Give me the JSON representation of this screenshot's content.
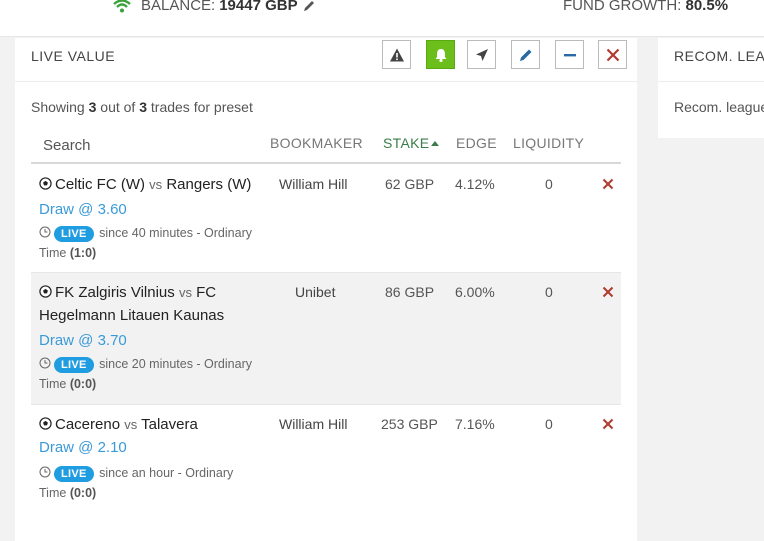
{
  "topbar": {
    "balance_label": "BALANCE:",
    "balance_value": "19447 GBP",
    "growth_label": "FUND GROWTH:",
    "growth_value": "80.5%"
  },
  "panel": {
    "title": "LIVE VALUE",
    "tools": [
      "warning-icon",
      "bell-icon",
      "send-icon",
      "pencil-icon",
      "minus-icon",
      "close-icon"
    ],
    "showing_prefix": "Showing",
    "showing_count": "3",
    "showing_middle": "out of",
    "showing_total": "3",
    "showing_suffix": "trades for preset"
  },
  "table": {
    "search_placeholder": "Search",
    "headers": {
      "bookmaker": "BOOKMAKER",
      "stake": "STAKE",
      "edge": "EDGE",
      "liquidity": "LIQUIDITY"
    },
    "rows": [
      {
        "home": "Celtic FC (W)",
        "vs": "vs",
        "away": "Rangers (W)",
        "bet": "Draw @ 3.60",
        "live": "LIVE",
        "since": "since 40 minutes - Ordinary Time",
        "score": "(1:0)",
        "bookmaker": "William Hill",
        "stake": "62 GBP",
        "edge": "4.12%",
        "liquidity": "0"
      },
      {
        "home": "FK Zalgiris Vilnius",
        "vs": "vs",
        "away": "FC Hegelmann Litauen Kaunas",
        "bet": "Draw @ 3.70",
        "live": "LIVE",
        "since": "since 20 minutes - Ordinary Time",
        "score": "(0:0)",
        "bookmaker": "Unibet",
        "stake": "86 GBP",
        "edge": "6.00%",
        "liquidity": "0"
      },
      {
        "home": "Cacereno",
        "vs": "vs",
        "away": "Talavera",
        "bet": "Draw @ 2.10",
        "live": "LIVE",
        "since": "since an hour - Ordinary Time",
        "score": "(0:0)",
        "bookmaker": "William Hill",
        "stake": "253 GBP",
        "edge": "7.16%",
        "liquidity": "0"
      }
    ]
  },
  "right_panel": {
    "title": "RECOM. LEA",
    "text": "Recom. league"
  },
  "colors": {
    "accent_green": "#6cbf1a",
    "link_blue": "#3a9ad9",
    "live_blue": "#1f9de0",
    "delete_red": "#b03a2e",
    "stake_green": "#3a7d4a"
  }
}
